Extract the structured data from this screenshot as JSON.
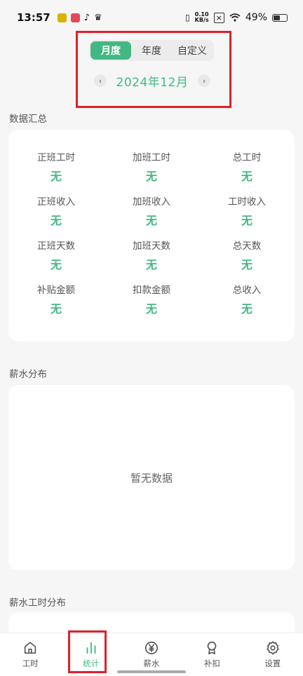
{
  "status_bar": {
    "time": "13:57",
    "net_speed_value": "0.10",
    "net_speed_unit": "KB/s",
    "battery": "49%",
    "battery_level": 0.49,
    "icons": [
      "app-icon",
      "app-icon",
      "tiktok-icon",
      "crown-icon",
      "vibrate-icon",
      "no-sim-icon",
      "wifi-icon",
      "battery-icon"
    ]
  },
  "period_tabs": [
    {
      "label": "月度",
      "active": true
    },
    {
      "label": "年度",
      "active": false
    },
    {
      "label": "自定义",
      "active": false
    }
  ],
  "month_picker": {
    "label": "2024年12月",
    "prev_icon": "chevron-left-icon",
    "next_icon": "chevron-right-icon"
  },
  "summary": {
    "title": "数据汇总",
    "items": [
      {
        "label": "正班工时",
        "value": "无"
      },
      {
        "label": "加班工时",
        "value": "无"
      },
      {
        "label": "总工时",
        "value": "无"
      },
      {
        "label": "正班收入",
        "value": "无"
      },
      {
        "label": "加班收入",
        "value": "无"
      },
      {
        "label": "工时收入",
        "value": "无"
      },
      {
        "label": "正班天数",
        "value": "无"
      },
      {
        "label": "加班天数",
        "value": "无"
      },
      {
        "label": "总天数",
        "value": "无"
      },
      {
        "label": "补贴金额",
        "value": "无"
      },
      {
        "label": "扣款金额",
        "value": "无"
      },
      {
        "label": "总收入",
        "value": "无"
      }
    ]
  },
  "salary_distribution": {
    "title": "薪水分布",
    "empty_text": "暂无数据"
  },
  "salary_hours_distribution": {
    "title": "薪水工时分布"
  },
  "bottom_nav": [
    {
      "label": "工时",
      "icon": "home-icon",
      "active": false
    },
    {
      "label": "统计",
      "icon": "bar-chart-icon",
      "active": true
    },
    {
      "label": "薪水",
      "icon": "yuan-icon",
      "active": false
    },
    {
      "label": "补扣",
      "icon": "award-icon",
      "active": false
    },
    {
      "label": "设置",
      "icon": "gear-icon",
      "active": false
    }
  ],
  "colors": {
    "accent": "#43b884",
    "background": "#f6f6f6",
    "highlight": "#e0202a"
  }
}
